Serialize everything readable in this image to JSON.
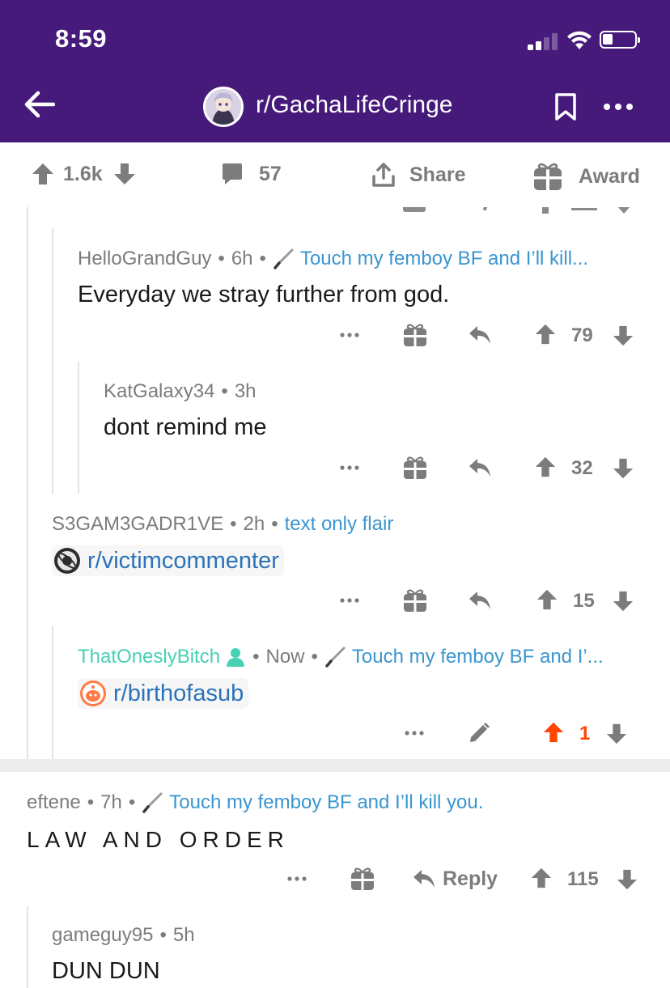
{
  "status_bar": {
    "time": "8:59"
  },
  "nav": {
    "subreddit": "r/GachaLifeCringe"
  },
  "actions": {
    "upvotes": "1.6k",
    "comments": "57",
    "share": "Share",
    "award": "Award"
  },
  "comments": [
    {
      "user": "HelloGrandGuy",
      "time": "6h",
      "flair": "Touch my femboy BF and I’ll kill...",
      "text": "Everyday we stray further from god.",
      "score": "79"
    },
    {
      "user": "KatGalaxy34",
      "time": "3h",
      "text": "dont remind me",
      "score": "32"
    },
    {
      "user": "S3GAM3GADR1VE",
      "time": "2h",
      "flair": "text only flair",
      "link": "r/victimcommenter",
      "score": "15"
    },
    {
      "user": "ThatOneslyBitch",
      "time": "Now",
      "flair": "Touch my femboy BF and I’...",
      "link": "r/birthofasub",
      "score": "1"
    },
    {
      "user": "eftene",
      "time": "7h",
      "flair": "Touch my femboy BF and I’ll kill you.",
      "text": "LAW AND ORDER",
      "reply": "Reply",
      "score": "115"
    },
    {
      "user": "gameguy95",
      "time": "5h",
      "text": "DUN DUN"
    }
  ],
  "colors": {
    "header_bg": "#461a7a",
    "flair": "#3a95d0",
    "link": "#2b72b9",
    "upvoted": "#ff4500",
    "op_user": "#46d1b4"
  }
}
